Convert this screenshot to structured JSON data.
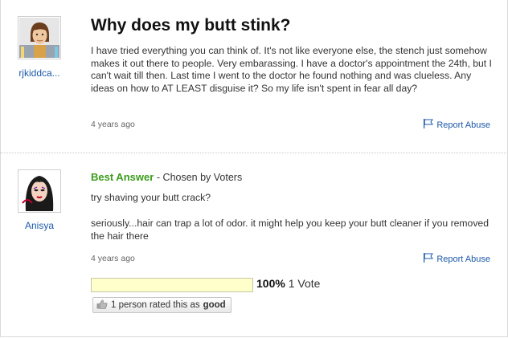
{
  "question": {
    "username": "rjkiddca...",
    "title": "Why does my butt stink?",
    "body": "I have tried everything you can think of. It's not like everyone else, the stench just somehow makes it out there to people. Very embarassing. I have a doctor's appointment the 24th, but I can't wait till then. Last time I went to the doctor he found nothing and was clueless. Any ideas on how to AT LEAST disguise it? So my life isn't spent in fear all day?",
    "age": "4 years ago",
    "report_label": "Report Abuse"
  },
  "answer": {
    "username": "Anisya",
    "best_label": "Best Answer",
    "chosen_by": "- Chosen by Voters",
    "line1": "try shaving your butt crack?",
    "line2": "seriously...hair can trap a lot of odor. it might help you keep your butt cleaner if you removed the hair there",
    "age": "4 years ago",
    "report_label": "Report Abuse",
    "vote_percent_label": "100%",
    "vote_count_label": "1 Vote",
    "vote_fraction": 1.0,
    "rating_text": "1 person rated this as",
    "rating_value": "good"
  },
  "icons": {
    "report": "flag-icon",
    "rate": "thumbs-up-icon"
  },
  "colors": {
    "link": "#1c58a8",
    "best_answer": "#3b9c1b",
    "vote_bar": "#ffffcc"
  }
}
